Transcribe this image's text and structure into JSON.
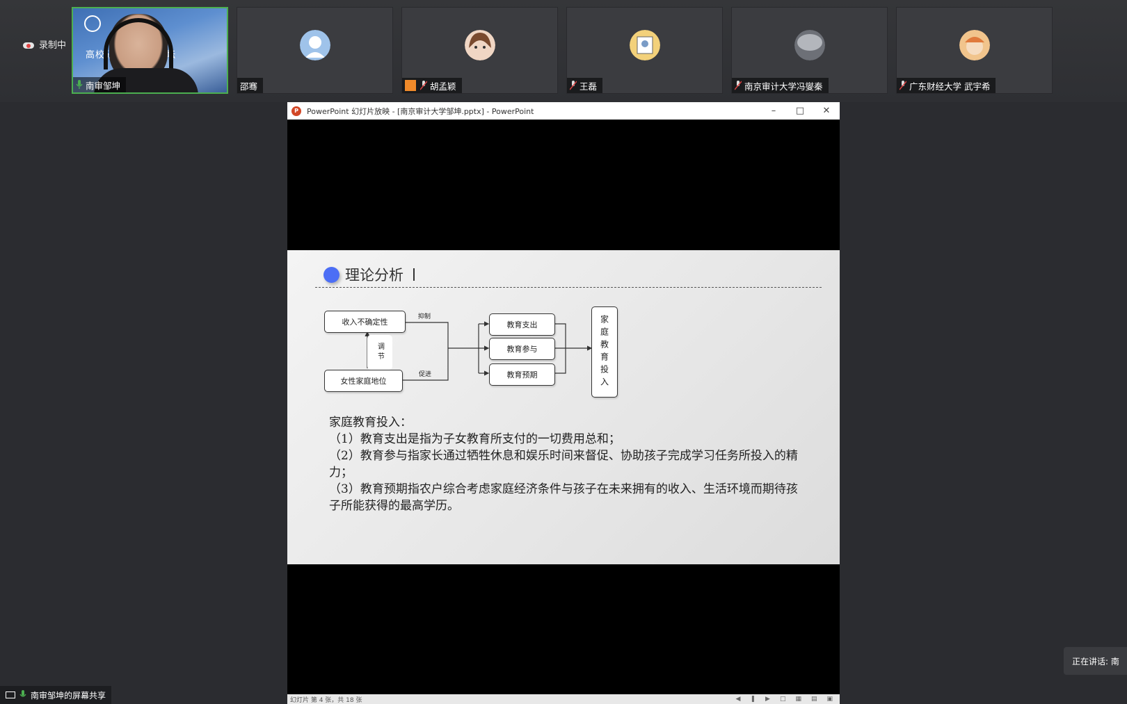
{
  "recording": {
    "label": "录制中"
  },
  "participants": [
    {
      "name": "南审邹坤",
      "video_text": "高校研",
      "video_text2": "）论坛",
      "mic": "active"
    },
    {
      "name": "邵骞",
      "mic": "none"
    },
    {
      "name": "胡孟颖",
      "mic": "muted"
    },
    {
      "name": "王磊",
      "mic": "muted"
    },
    {
      "name": "南京审计大学冯燮秦",
      "mic": "muted"
    },
    {
      "name": "广东财经大学 武宇希",
      "mic": "muted"
    }
  ],
  "ppt": {
    "title": "PowerPoint 幻灯片放映 - [南京审计大学邹坤.pptx] - PowerPoint",
    "status": "幻灯片 第 4 张，共 18 张"
  },
  "slide": {
    "title": "理论分析",
    "diagram": {
      "income": "收入不确定性",
      "female": "女性家庭地位",
      "regulate": "调节",
      "suppress": "抑制",
      "promote": "促进",
      "spend": "教育支出",
      "participate": "教育参与",
      "expect": "教育预期",
      "invest": "家庭教育投入"
    },
    "text": [
      "家庭教育投入：",
      "（1）教育支出是指为子女教育所支付的一切费用总和；",
      "（2）教育参与指家长通过牺牲休息和娱乐时间来督促、协助孩子完成学习任务所投入的精力；",
      "（3）教育预期指农户综合考虑家庭经济条件与孩子在未来拥有的收入、生活环境而期待孩子所能获得的最高学历。"
    ]
  },
  "share": {
    "label": "南审邹坤的屏幕共享"
  },
  "speaking": {
    "label": "正在讲话: 南"
  },
  "colors": {
    "active_border": "#4caf50",
    "accent_dot": "#4c6ef5",
    "mic_active": "#4caf50"
  }
}
